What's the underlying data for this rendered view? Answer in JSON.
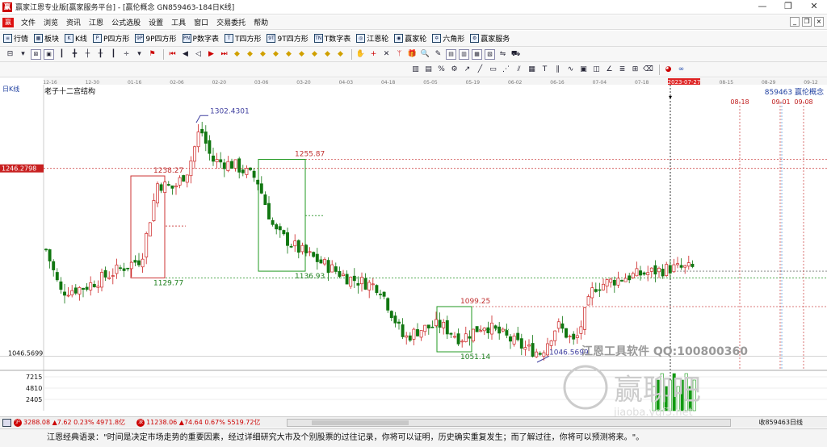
{
  "window": {
    "title": "赢家江恩专业版[赢家服务平台] - [赢伦概念  GN859463-184日K线]",
    "app_icon": "赢",
    "controls": [
      "—",
      "❐",
      "✕"
    ]
  },
  "menu": {
    "logo": "赢",
    "items": [
      "文件",
      "浏览",
      "资讯",
      "江恩",
      "公式选股",
      "设置",
      "工具",
      "窗口",
      "交易委托",
      "帮助"
    ],
    "controls": [
      "_",
      "❐",
      "×"
    ]
  },
  "toolbar1": [
    {
      "icon": "grid-icon",
      "glyph": "≡",
      "label": "行情"
    },
    {
      "icon": "block-icon",
      "glyph": "▦",
      "label": "板块"
    },
    {
      "icon": "kline-icon",
      "glyph": "K",
      "label": "K线"
    },
    {
      "icon": "p-square-icon",
      "glyph": "P",
      "label": "P四方形"
    },
    {
      "icon": "9p-square-icon",
      "glyph": "9P",
      "label": "9P四方形"
    },
    {
      "icon": "pn-table-icon",
      "glyph": "PN",
      "label": "P数字表"
    },
    {
      "icon": "t-square-icon",
      "glyph": "T",
      "label": "T四方形"
    },
    {
      "icon": "9t-square-icon",
      "glyph": "9T",
      "label": "9T四方形"
    },
    {
      "icon": "tn-table-icon",
      "glyph": "TN",
      "label": "T数字表"
    },
    {
      "icon": "gann-wheel-icon",
      "glyph": "◎",
      "label": "江恩轮"
    },
    {
      "icon": "winner-wheel-icon",
      "glyph": "◉",
      "label": "赢家轮"
    },
    {
      "icon": "hexagon-icon",
      "glyph": "✡",
      "label": "六角形"
    },
    {
      "icon": "service-icon",
      "glyph": "⚙",
      "label": "赢家服务"
    }
  ],
  "chart_data": {
    "type": "candlestick",
    "title": "老子十二宫结构",
    "period_label": "日K线",
    "legend_right": "859463  赢伦概念",
    "date_axis": [
      "12-16",
      "12-30",
      "01-16",
      "02-06",
      "02-20",
      "03-06",
      "03-20",
      "04-03",
      "04-18",
      "05-05",
      "05-19",
      "06-02",
      "06-16",
      "07-04",
      "07-18",
      "2023-07-27",
      "08-15",
      "08-29",
      "09-12"
    ],
    "highlight_date": "2023-07-27",
    "price_levels": [
      {
        "label": "1302.4301",
        "value": 1302.43,
        "color": "#4040a0"
      },
      {
        "label": "1255.87",
        "value": 1255.87,
        "color": "#c03030"
      },
      {
        "label": "1238.27",
        "value": 1238.27,
        "color": "#c03030"
      },
      {
        "label": "1136.93",
        "value": 1136.93,
        "color": "#208020"
      },
      {
        "label": "1129.77",
        "value": 1129.77,
        "color": "#208020"
      },
      {
        "label": "1099.25",
        "value": 1099.25,
        "color": "#c03030"
      },
      {
        "label": "1051.14",
        "value": 1051.14,
        "color": "#208020"
      },
      {
        "label": "1046.5699",
        "value": 1046.57,
        "color": "#4040a0"
      }
    ],
    "current_price_label": "1246.2798",
    "current_price": 1246.28,
    "ylim": [
      1040,
      1325
    ],
    "bottom_axis_label": "1046.5699",
    "projected_dates": [
      "08-18",
      "09-01",
      "09-08"
    ],
    "volume_axis": [
      "7215",
      "4810",
      "2405"
    ],
    "watermark_1": "江恩工具软件  QQ:100800360",
    "watermark_2": "赢聊吧",
    "watermark_3": "jiaoba.ygf3.net",
    "colors": {
      "up": "#cc2222",
      "down": "#117711",
      "box_red": "#cc3333",
      "box_green": "#229922"
    }
  },
  "status": {
    "index1_badge": "沪",
    "index1": "3288.08 ▲7.62 0.23% 4971.8亿",
    "index2_badge": "深",
    "index2": "11238.06 ▲74.64 0.67% 5519.72亿",
    "right_text": "收859463日线"
  },
  "quote": "江恩经典语录：\"时间是决定市场走势的重要因素，经过详细研究大市及个别股票的过往记录，你将可以证明，历史确实重复发生；而了解过往，你将可以预测将来。\"。"
}
